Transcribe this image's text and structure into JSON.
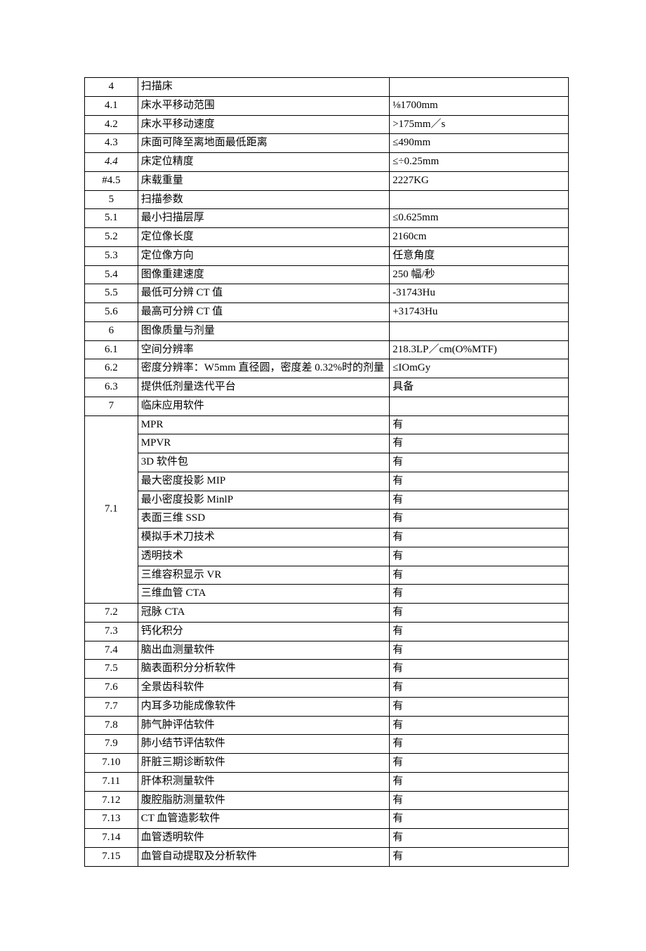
{
  "rows": [
    {
      "num": "4",
      "desc": "扫描床",
      "val": ""
    },
    {
      "num": "4.1",
      "desc": "床水平移动范围",
      "val": "⅛1700mm"
    },
    {
      "num": "4.2",
      "desc": "床水平移动速度",
      "val": ">175mm／s"
    },
    {
      "num": "4.3",
      "desc": "床面可降至离地面最低距离",
      "val": "≤490mm"
    },
    {
      "num": "4.4",
      "desc": "床定位精度",
      "val": "≤÷0.25mm",
      "numClass": "italic"
    },
    {
      "num": "#4.5",
      "desc": "床载重量",
      "val": "2227KG"
    },
    {
      "num": "5",
      "desc": "扫描参数",
      "val": ""
    },
    {
      "num": "5.1",
      "desc": "最小扫描层厚",
      "val": "≤0.625mm"
    },
    {
      "num": "5.2",
      "desc": "定位像长度",
      "val": "2160cm"
    },
    {
      "num": "5.3",
      "desc": "定位像方向",
      "val": "任意角度"
    },
    {
      "num": "5.4",
      "desc": "图像重建速度",
      "val": "250 幅/秒"
    },
    {
      "num": "5.5",
      "desc": "最低可分辨 CT 值",
      "val": "-31743Hu"
    },
    {
      "num": "5.6",
      "desc": "最高可分辨 CT 值",
      "val": "+31743Hu"
    },
    {
      "num": "6",
      "desc": "图像质量与剂量",
      "val": ""
    },
    {
      "num": "6.1",
      "desc": "空间分辨率",
      "val": "218.3LP／cm(O%MTF)"
    },
    {
      "num": "6.2",
      "desc": "密度分辨率：W5mm 直径圆，密度差 0.32%时的剂量",
      "val": "≤IOmGy"
    },
    {
      "num": "6.3",
      "desc": "提供低剂量迭代平台",
      "val": "具备"
    },
    {
      "num": "7",
      "desc": "临床应用软件",
      "val": ""
    },
    {
      "num": "7.1",
      "span": 10,
      "items": [
        {
          "desc": "MPR",
          "val": "有"
        },
        {
          "desc": "MPVR",
          "val": "有"
        },
        {
          "desc": "3D 软件包",
          "val": "有"
        },
        {
          "desc": "最大密度投影 MIP",
          "val": "有"
        },
        {
          "desc": "最小密度投影 MinlP",
          "val": "有"
        },
        {
          "desc": "表面三维 SSD",
          "val": "有"
        },
        {
          "desc": "模拟手术刀技术",
          "val": "有"
        },
        {
          "desc": "透明技术",
          "val": "有"
        },
        {
          "desc": "三维容积显示 VR",
          "val": "有"
        },
        {
          "desc": "三维血管 CTA",
          "val": "有"
        }
      ]
    },
    {
      "num": "7.2",
      "desc": "冠脉 CTA",
      "val": "有"
    },
    {
      "num": "7.3",
      "desc": "钙化积分",
      "val": "有"
    },
    {
      "num": "7.4",
      "desc": "脑出血测量软件",
      "val": "有"
    },
    {
      "num": "7.5",
      "desc": "脑表面积分分析软件",
      "val": "有"
    },
    {
      "num": "7.6",
      "desc": "全景齿科软件",
      "val": "有"
    },
    {
      "num": "7.7",
      "desc": "内耳多功能成像软件",
      "val": "有"
    },
    {
      "num": "7.8",
      "desc": "肺气肿评估软件",
      "val": "有"
    },
    {
      "num": "7.9",
      "desc": "肺小结节评估软件",
      "val": "有"
    },
    {
      "num": "7.10",
      "desc": "肝脏三期诊断软件",
      "val": "有"
    },
    {
      "num": "7.11",
      "desc": "肝体积测量软件",
      "val": "有"
    },
    {
      "num": "7.12",
      "desc": "腹腔脂肪测量软件",
      "val": "有"
    },
    {
      "num": "7.13",
      "desc": "CT 血管造影软件",
      "val": "有"
    },
    {
      "num": "7.14",
      "desc": "血管透明软件",
      "val": "有"
    },
    {
      "num": "7.15",
      "desc": "血管自动提取及分析软件",
      "val": "有"
    }
  ]
}
